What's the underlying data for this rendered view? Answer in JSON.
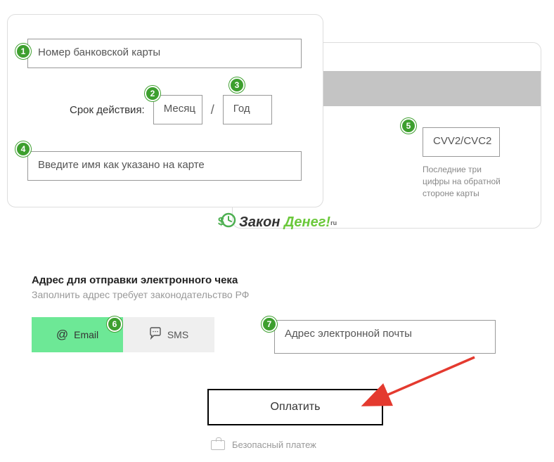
{
  "card": {
    "number_placeholder": "Номер банковской карты",
    "expiry_label": "Срок действия:",
    "month_placeholder": "Месяц",
    "year_placeholder": "Год",
    "name_placeholder": "Введите имя как указано на карте",
    "cvv_placeholder": "CVV2/CVC2",
    "cvv_hint_l1": "Последние три",
    "cvv_hint_l2": "цифры на обратной",
    "cvv_hint_l3": "стороне карты"
  },
  "badges": {
    "b1": "1",
    "b2": "2",
    "b3": "3",
    "b4": "4",
    "b5": "5",
    "b6": "6",
    "b7": "7"
  },
  "logo": {
    "text1": "Закон",
    "text2": "Денег!",
    "ru": "ru"
  },
  "receipt": {
    "title": "Адрес для отправки электронного чека",
    "subtitle": "Заполнить адрес требует законодательство РФ",
    "tab_email": "Email",
    "tab_sms": "SMS",
    "email_placeholder": "Адрес электронной почты"
  },
  "pay_label": "Оплатить",
  "secure_label": "Безопасный платеж"
}
